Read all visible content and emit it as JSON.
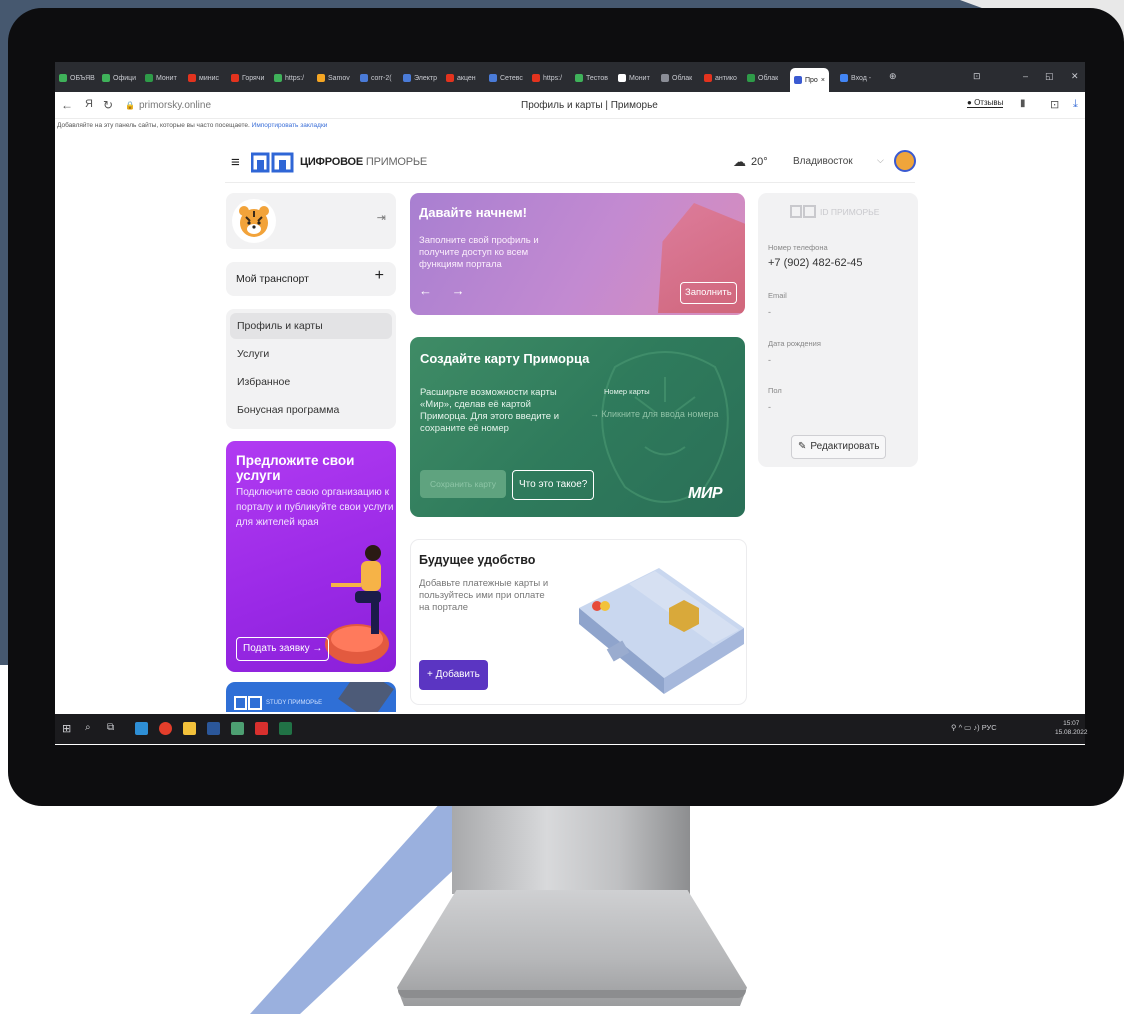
{
  "browser": {
    "tabs": [
      {
        "label": "ОБЪЯВ",
        "icon": "green-doc-icon",
        "color": "#3fb25a"
      },
      {
        "label": "Офици",
        "icon": "green-doc-icon",
        "color": "#3fb25a"
      },
      {
        "label": "Монит",
        "icon": "sheet-icon",
        "color": "#2e9b48"
      },
      {
        "label": "минис",
        "icon": "yandex-icon",
        "color": "#e3331e"
      },
      {
        "label": "Горячи",
        "icon": "yandex-icon",
        "color": "#e3331e"
      },
      {
        "label": "https:/",
        "icon": "green-doc-icon",
        "color": "#3fb25a"
      },
      {
        "label": "Samov",
        "icon": "orange-icon",
        "color": "#f5a623"
      },
      {
        "label": "corr-2(",
        "icon": "doc-icon",
        "color": "#4a7bd8"
      },
      {
        "label": "Электр",
        "icon": "doc-icon",
        "color": "#4a7bd8"
      },
      {
        "label": "акцен",
        "icon": "yandex-icon",
        "color": "#e3331e"
      },
      {
        "label": "Сетевс",
        "icon": "doc-icon",
        "color": "#4a7bd8"
      },
      {
        "label": "https:/",
        "icon": "yandex-icon",
        "color": "#e3331e"
      },
      {
        "label": "Тестов",
        "icon": "green-icon",
        "color": "#3fb25a"
      },
      {
        "label": "Монит",
        "icon": "white-icon",
        "color": "#ffffff"
      },
      {
        "label": "Облак",
        "icon": "cloud-icon",
        "color": "#8a8d96"
      },
      {
        "label": "антико",
        "icon": "yandex-icon",
        "color": "#e3331e"
      },
      {
        "label": "Облак",
        "icon": "sheet-icon",
        "color": "#2e9b48"
      },
      {
        "label": "Про",
        "icon": "cp-icon",
        "color": "#3a5ad1",
        "active": true
      },
      {
        "label": "Вход -",
        "icon": "google-icon",
        "color": "#4285f4"
      }
    ],
    "url": "primorsky.online",
    "page_title": "Профиль и карты | Приморье",
    "reviews": "Отзывы",
    "bookmark_hint": "Добавляйте на эту панель сайты, которые вы часто посещаете.",
    "bookmark_link": "Импортировать закладки"
  },
  "site": {
    "logo_bold": "ЦИФРОВОЕ",
    "logo_light": "ПРИМОРЬЕ",
    "temperature": "20°",
    "city": "Владивосток"
  },
  "sidebar": {
    "transport": "Мой транспорт",
    "menu": [
      {
        "label": "Профиль и карты",
        "active": true
      },
      {
        "label": "Услуги"
      },
      {
        "label": "Избранное"
      },
      {
        "label": "Бонусная программа"
      }
    ],
    "offer": {
      "title": "Предложите свои услуги",
      "text": "Подключите свою организацию к порталу и публикуйте свои услуги для жителей края",
      "button": "Подать заявку →"
    },
    "study_label": "STUDY ПРИМОРЬЕ"
  },
  "start": {
    "title": "Давайте начнем!",
    "text": "Заполните свой профиль и получите доступ ко всем функциям портала",
    "arrows": "← →",
    "button": "Заполнить"
  },
  "mir": {
    "title": "Создайте карту Приморца",
    "text": "Расширьте возможности карты «Мир», сделав её картой Приморца. Для этого введите и сохраните её номер",
    "number_label": "Номер карты",
    "number_placeholder": "→ Кликните для ввода номера",
    "save_button": "Сохранить карту",
    "what_button": "Что это такое?",
    "logo": "МИР"
  },
  "future": {
    "title": "Будущее удобство",
    "text": "Добавьте платежные карты и пользуйтесь ими при оплате на портале",
    "button": "+ Добавить"
  },
  "id_card": {
    "logo": "ID ПРИМОРЬЕ",
    "phone_label": "Номер телефона",
    "phone": "+7 (902) 482-62-45",
    "email_label": "Email",
    "email": "-",
    "birth_label": "Дата рождения",
    "birth": "-",
    "sex_label": "Пол",
    "sex": "-",
    "edit_button": "Редактировать"
  },
  "taskbar": {
    "lang": "РУС",
    "time": "15:07",
    "date": "15.08.2022"
  },
  "colors": {
    "accent_purple": "#5b35c2",
    "offer_purple": "#a231ec",
    "mir_green": "#347e5d",
    "brand_blue": "#3a5ad1"
  }
}
